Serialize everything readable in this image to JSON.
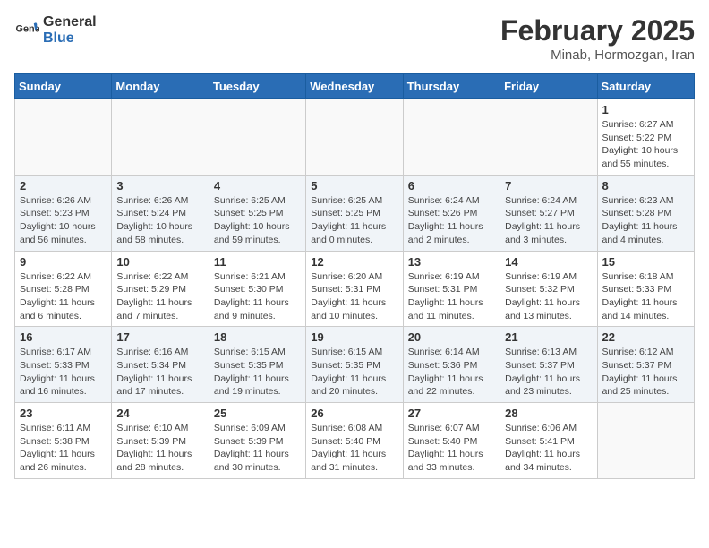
{
  "header": {
    "logo_line1": "General",
    "logo_line2": "Blue",
    "month_title": "February 2025",
    "location": "Minab, Hormozgan, Iran"
  },
  "days_of_week": [
    "Sunday",
    "Monday",
    "Tuesday",
    "Wednesday",
    "Thursday",
    "Friday",
    "Saturday"
  ],
  "weeks": [
    {
      "days": [
        {
          "num": "",
          "info": ""
        },
        {
          "num": "",
          "info": ""
        },
        {
          "num": "",
          "info": ""
        },
        {
          "num": "",
          "info": ""
        },
        {
          "num": "",
          "info": ""
        },
        {
          "num": "",
          "info": ""
        },
        {
          "num": "1",
          "info": "Sunrise: 6:27 AM\nSunset: 5:22 PM\nDaylight: 10 hours and 55 minutes."
        }
      ]
    },
    {
      "days": [
        {
          "num": "2",
          "info": "Sunrise: 6:26 AM\nSunset: 5:23 PM\nDaylight: 10 hours and 56 minutes."
        },
        {
          "num": "3",
          "info": "Sunrise: 6:26 AM\nSunset: 5:24 PM\nDaylight: 10 hours and 58 minutes."
        },
        {
          "num": "4",
          "info": "Sunrise: 6:25 AM\nSunset: 5:25 PM\nDaylight: 10 hours and 59 minutes."
        },
        {
          "num": "5",
          "info": "Sunrise: 6:25 AM\nSunset: 5:25 PM\nDaylight: 11 hours and 0 minutes."
        },
        {
          "num": "6",
          "info": "Sunrise: 6:24 AM\nSunset: 5:26 PM\nDaylight: 11 hours and 2 minutes."
        },
        {
          "num": "7",
          "info": "Sunrise: 6:24 AM\nSunset: 5:27 PM\nDaylight: 11 hours and 3 minutes."
        },
        {
          "num": "8",
          "info": "Sunrise: 6:23 AM\nSunset: 5:28 PM\nDaylight: 11 hours and 4 minutes."
        }
      ]
    },
    {
      "days": [
        {
          "num": "9",
          "info": "Sunrise: 6:22 AM\nSunset: 5:28 PM\nDaylight: 11 hours and 6 minutes."
        },
        {
          "num": "10",
          "info": "Sunrise: 6:22 AM\nSunset: 5:29 PM\nDaylight: 11 hours and 7 minutes."
        },
        {
          "num": "11",
          "info": "Sunrise: 6:21 AM\nSunset: 5:30 PM\nDaylight: 11 hours and 9 minutes."
        },
        {
          "num": "12",
          "info": "Sunrise: 6:20 AM\nSunset: 5:31 PM\nDaylight: 11 hours and 10 minutes."
        },
        {
          "num": "13",
          "info": "Sunrise: 6:19 AM\nSunset: 5:31 PM\nDaylight: 11 hours and 11 minutes."
        },
        {
          "num": "14",
          "info": "Sunrise: 6:19 AM\nSunset: 5:32 PM\nDaylight: 11 hours and 13 minutes."
        },
        {
          "num": "15",
          "info": "Sunrise: 6:18 AM\nSunset: 5:33 PM\nDaylight: 11 hours and 14 minutes."
        }
      ]
    },
    {
      "days": [
        {
          "num": "16",
          "info": "Sunrise: 6:17 AM\nSunset: 5:33 PM\nDaylight: 11 hours and 16 minutes."
        },
        {
          "num": "17",
          "info": "Sunrise: 6:16 AM\nSunset: 5:34 PM\nDaylight: 11 hours and 17 minutes."
        },
        {
          "num": "18",
          "info": "Sunrise: 6:15 AM\nSunset: 5:35 PM\nDaylight: 11 hours and 19 minutes."
        },
        {
          "num": "19",
          "info": "Sunrise: 6:15 AM\nSunset: 5:35 PM\nDaylight: 11 hours and 20 minutes."
        },
        {
          "num": "20",
          "info": "Sunrise: 6:14 AM\nSunset: 5:36 PM\nDaylight: 11 hours and 22 minutes."
        },
        {
          "num": "21",
          "info": "Sunrise: 6:13 AM\nSunset: 5:37 PM\nDaylight: 11 hours and 23 minutes."
        },
        {
          "num": "22",
          "info": "Sunrise: 6:12 AM\nSunset: 5:37 PM\nDaylight: 11 hours and 25 minutes."
        }
      ]
    },
    {
      "days": [
        {
          "num": "23",
          "info": "Sunrise: 6:11 AM\nSunset: 5:38 PM\nDaylight: 11 hours and 26 minutes."
        },
        {
          "num": "24",
          "info": "Sunrise: 6:10 AM\nSunset: 5:39 PM\nDaylight: 11 hours and 28 minutes."
        },
        {
          "num": "25",
          "info": "Sunrise: 6:09 AM\nSunset: 5:39 PM\nDaylight: 11 hours and 30 minutes."
        },
        {
          "num": "26",
          "info": "Sunrise: 6:08 AM\nSunset: 5:40 PM\nDaylight: 11 hours and 31 minutes."
        },
        {
          "num": "27",
          "info": "Sunrise: 6:07 AM\nSunset: 5:40 PM\nDaylight: 11 hours and 33 minutes."
        },
        {
          "num": "28",
          "info": "Sunrise: 6:06 AM\nSunset: 5:41 PM\nDaylight: 11 hours and 34 minutes."
        },
        {
          "num": "",
          "info": ""
        }
      ]
    }
  ]
}
